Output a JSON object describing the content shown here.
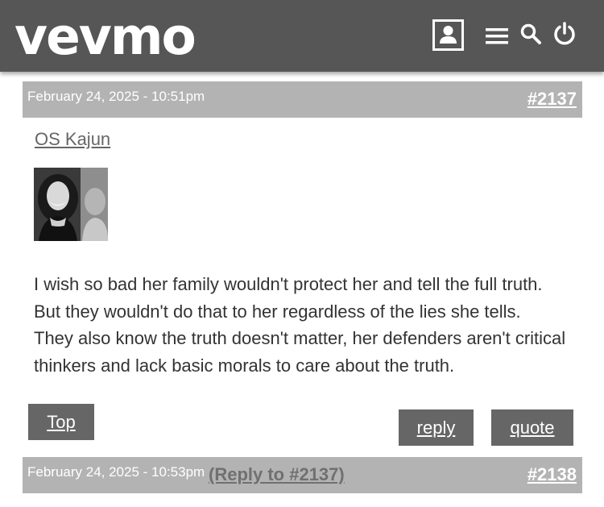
{
  "header": {
    "logo": "vevmo",
    "icons": [
      "profile-icon",
      "menu-icon",
      "search-icon",
      "power-icon"
    ]
  },
  "posts": [
    {
      "date": "February 24, 2025 - 10:51pm",
      "number": "#2137",
      "username": "OS Kajun",
      "body": [
        "I wish so bad her family wouldn't protect her and tell the full truth.",
        "But they wouldn't do that to her regardless of the lies she tells.",
        "They also know the truth doesn't matter, her defenders aren't critical thinkers and lack basic morals to care about the truth."
      ]
    },
    {
      "date": "February 24, 2025 - 10:53pm",
      "reply_to": "(Reply to #2137)",
      "number": "#2138"
    }
  ],
  "actions": {
    "top": "Top",
    "reply": "reply",
    "quote": "quote"
  },
  "colors": {
    "topbar": "#565656",
    "post_header": "#b3b3b3",
    "button": "#666666",
    "text": "#333333"
  }
}
